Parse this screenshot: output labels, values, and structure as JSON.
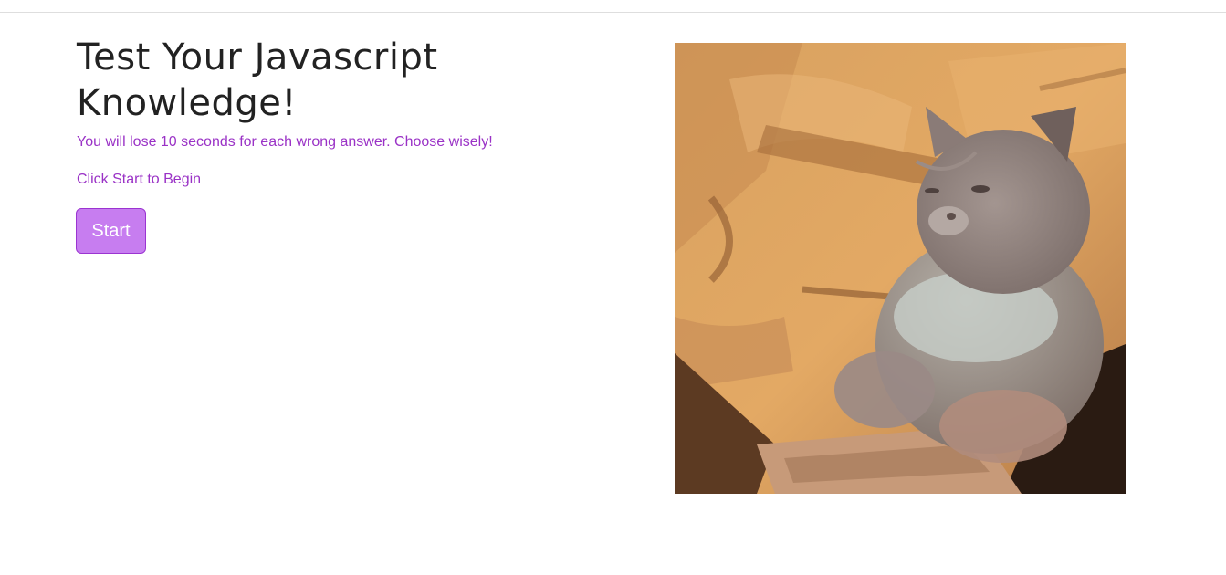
{
  "header": {
    "title": "Test Your Javascript Knowledge!",
    "warning": "You will lose 10 seconds for each wrong answer. Choose wisely!",
    "prompt": "Click Start to Begin"
  },
  "controls": {
    "start_label": "Start"
  },
  "colors": {
    "accent_text": "#9a32c6",
    "button_fill": "#c77df0",
    "button_border": "#9b34d1",
    "title_text": "#222222"
  },
  "hero_image": {
    "icon": "cat-typing-image"
  }
}
